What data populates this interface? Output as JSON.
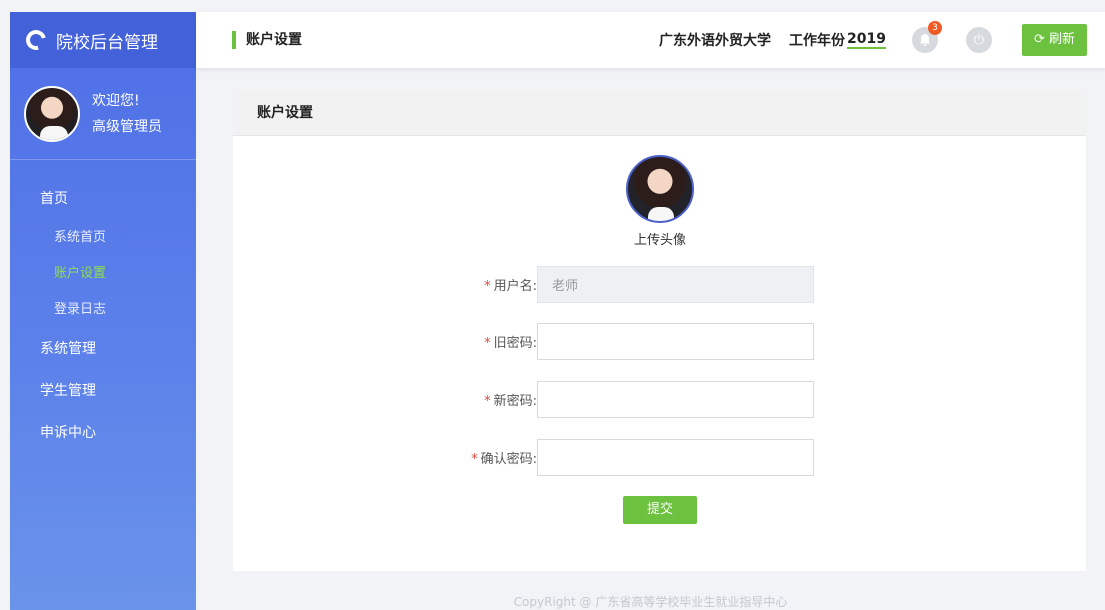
{
  "sidebar": {
    "logo_text": "院校后台管理",
    "welcome": "欢迎您!",
    "role": "高级管理员",
    "groups": [
      {
        "label": "首页",
        "items": [
          "系统首页",
          "账户设置",
          "登录日志"
        ]
      },
      {
        "label": "系统管理"
      },
      {
        "label": "学生管理"
      },
      {
        "label": "申诉中心"
      }
    ],
    "active_item": "账户设置"
  },
  "header": {
    "title": "账户设置",
    "school": "广东外语外贸大学",
    "year_label": "工作年份",
    "year_value": "2019",
    "notification_count": "3",
    "refresh_label": "刷新",
    "refresh_icon": "⟳",
    "power_icon": "⏻"
  },
  "card": {
    "title": "账户设置",
    "upload_label": "上传头像",
    "form": {
      "required_mark": "*",
      "username_label": "用户名:",
      "username_value": "老师",
      "old_password_label": "旧密码:",
      "new_password_label": "新密码:",
      "confirm_password_label": "确认密码:",
      "submit_label": "提交"
    }
  },
  "footer": {
    "copyright": "CopyRight @ 广东省高等学校毕业生就业指导中心"
  },
  "colors": {
    "accent_green": "#6cc13e",
    "sidebar_blue": "#4f6fe6",
    "badge_orange": "#f05a24"
  }
}
